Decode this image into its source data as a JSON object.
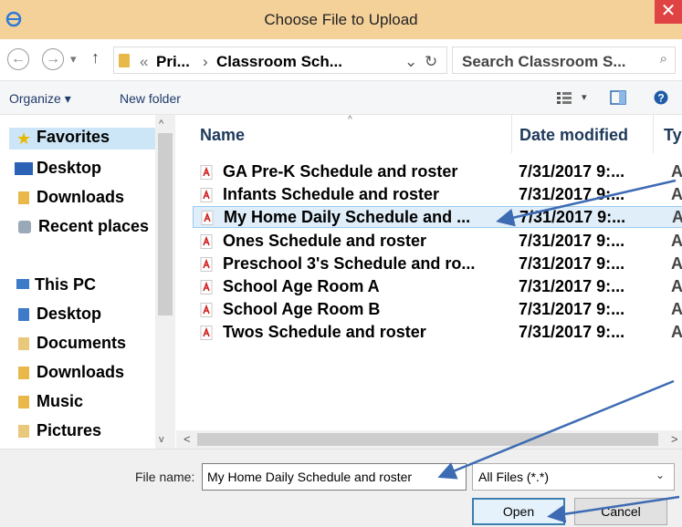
{
  "window": {
    "title": "Choose File to Upload",
    "close_glyph": "✕",
    "app_icon": "ie-icon"
  },
  "address": {
    "back_glyph": "←",
    "forward_glyph": "→",
    "recent_glyph": "▾",
    "up_glyph": "↑",
    "overflow": "«",
    "crumb1": "Pri...",
    "sep": "›",
    "crumb2": "Classroom Sch...",
    "dropdown_glyph": "⌄",
    "refresh_glyph": "↻",
    "search_placeholder": "Search Classroom S...",
    "search_glyph": "⌕"
  },
  "toolbar": {
    "organize": "Organize ▾",
    "new_folder": "New folder",
    "help_glyph": "?"
  },
  "sidebar": {
    "items": [
      {
        "label": "Favorites",
        "icon": "star-icon"
      },
      {
        "label": "Desktop",
        "icon": "desktop-icon"
      },
      {
        "label": "Downloads",
        "icon": "downloads-icon"
      },
      {
        "label": "Recent places",
        "icon": "recent-places-icon"
      },
      {
        "label": "This PC",
        "icon": "computer-icon"
      },
      {
        "label": "Desktop",
        "icon": "desktop-folder-icon"
      },
      {
        "label": "Documents",
        "icon": "documents-icon"
      },
      {
        "label": "Downloads",
        "icon": "downloads-folder-icon"
      },
      {
        "label": "Music",
        "icon": "music-icon"
      },
      {
        "label": "Pictures",
        "icon": "pictures-icon"
      }
    ]
  },
  "columns": {
    "name": "Name",
    "date": "Date modified",
    "type": "Ty"
  },
  "files": [
    {
      "name": "GA Pre-K Schedule and roster",
      "date": "7/31/2017 9:...",
      "type": "Ac"
    },
    {
      "name": "Infants Schedule and roster",
      "date": "7/31/2017 9:...",
      "type": "Ac"
    },
    {
      "name": "My Home Daily Schedule and ...",
      "date": "7/31/2017 9:...",
      "type": "Ac"
    },
    {
      "name": "Ones Schedule and roster",
      "date": "7/31/2017 9:...",
      "type": "Ac"
    },
    {
      "name": "Preschool 3's Schedule and ro...",
      "date": "7/31/2017 9:...",
      "type": "Ac"
    },
    {
      "name": "School Age Room A",
      "date": "7/31/2017 9:...",
      "type": "Ac"
    },
    {
      "name": "School Age Room B",
      "date": "7/31/2017 9:...",
      "type": "Ac"
    },
    {
      "name": "Twos Schedule and roster",
      "date": "7/31/2017 9:...",
      "type": "Ac"
    }
  ],
  "footer": {
    "file_name_label": "File name:",
    "file_name_value": "My Home Daily Schedule and roster",
    "filter_value": "All Files (*.*)",
    "dropdown_glyph": "⌄",
    "open_label": "Open",
    "cancel_label": "Cancel"
  },
  "colors": {
    "annotation_arrow": "#3d6bb3",
    "selection": "#cce8ff",
    "titlebar": "#f5d19a",
    "close": "#e04343"
  }
}
